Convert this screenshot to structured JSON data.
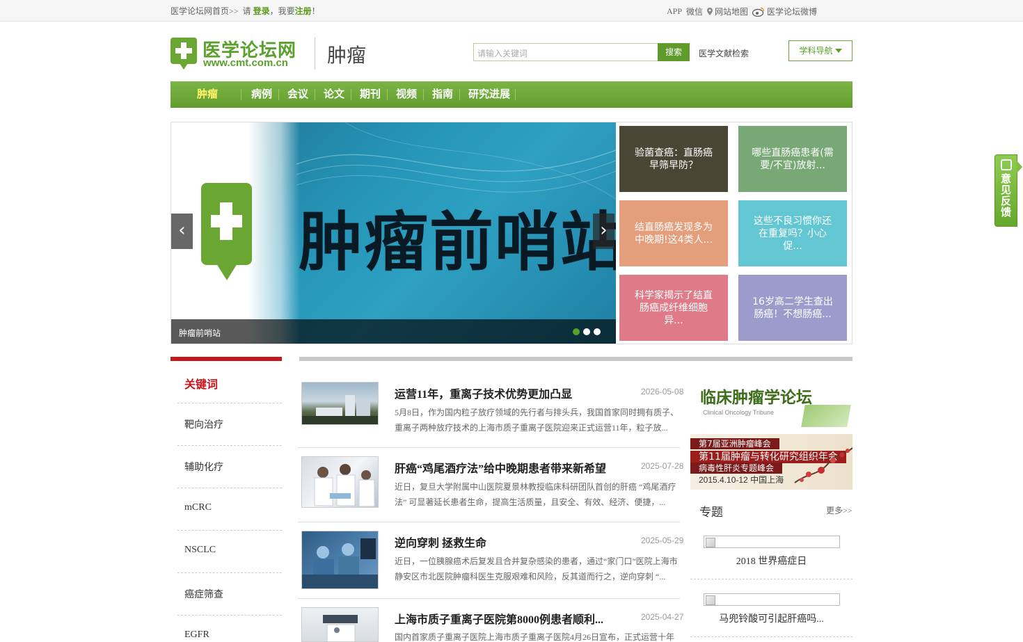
{
  "topbar": {
    "home_link": "医学论坛网首页>>",
    "please": "请",
    "login": "登录",
    "want": "，我要",
    "register": "注册",
    "exclaim": "！",
    "app": "APP",
    "wechat": "微信",
    "sitemap": "网站地图",
    "weibo": "医学论坛微博"
  },
  "header": {
    "logo_cn": "医学论坛网",
    "logo_url": "www.cmt.com.cn",
    "section_title": "肿瘤",
    "search_placeholder": "请输入关键词",
    "search_button": "搜索",
    "lit_search": "医学文献检索",
    "subject_nav": "学科导航"
  },
  "nav": {
    "items": [
      "肿瘤",
      "病例",
      "会议",
      "论文",
      "期刊",
      "视频",
      "指南",
      "研究进展"
    ],
    "active": "肿瘤"
  },
  "slider": {
    "banner_text": "肿瘤前哨站",
    "caption": "肿瘤前哨站",
    "prev": "‹",
    "next": "›",
    "dots_total": 3,
    "dot_active": 1
  },
  "tiles": [
    {
      "text": "验菌查癌：直肠癌早筛早防？",
      "color": "#4a4636"
    },
    {
      "text": "哪些直肠癌患者(需要/不宜)放射...",
      "color": "#77a876"
    },
    {
      "text": "结直肠癌发现多为中晚期!这4类人...",
      "color": "#e59e7b"
    },
    {
      "text": "这些不良习惯你还在重复吗？小心促...",
      "color": "#63c7d3"
    },
    {
      "text": "科学家揭示了结直肠癌成纤维细胞异...",
      "color": "#df7b88"
    },
    {
      "text": "16岁高二学生查出肠癌！不想肠癌...",
      "color": "#9b9ccb"
    }
  ],
  "keywords": {
    "heading": "关键词",
    "items": [
      "靶向治疗",
      "辅助化疗",
      "mCRC",
      "NSCLC",
      "癌症筛查",
      "EGFR"
    ]
  },
  "news": [
    {
      "title": "运营11年，重离子技术优势更加凸显",
      "date": "2026-05-08",
      "summary": "5月8日，作为国内粒子放疗领域的先行者与排头兵，我国首家同时拥有质子、重离子两种放疗技术的上海市质子重离子医院迎来正式运营11年，粒子放..."
    },
    {
      "title": "肝癌“鸡尾酒疗法”给中晚期患者带来新希望",
      "date": "2025-07-28",
      "summary": "近日，复旦大学附属中山医院夏景林教授临床科研团队首创的肝癌 “鸡尾酒疗法” 可显著延长患者生命，提高生活质量，且安全、有效、经济、便捷，..."
    },
    {
      "title": "逆向穿刺 拯救生命",
      "date": "2025-05-29",
      "summary": "近日，一位胰腺癌术后复发且合并复杂感染的患者，通过“家门口”医院上海市静安区市北医院肿瘤科医生克服艰难和风险，反其道而行之，逆向穿刺 “..."
    },
    {
      "title": "上海市质子重离子医院第8000例患者顺利...",
      "date": "2025-04-27",
      "summary": "国内首家质子重离子医院上海市质子重离子医院4月26日宣布，正式运营十年"
    }
  ],
  "right": {
    "banner1_title": "临床肿瘤学论坛",
    "banner1_sub": "Clinical Oncology Tribune",
    "banner2_lines": [
      "第7届亚洲肿瘤峰会",
      "第11届肿瘤与转化研究组织年会",
      "病毒性肝炎专题峰会"
    ],
    "banner2_date": "2015.4.10-12  中国上海",
    "topic_heading": "专题",
    "topic_more": "更多>>",
    "topics": [
      "2018 世界癌症日",
      "马兜铃酸可引起肝癌吗..."
    ]
  },
  "feedback": {
    "label": "意见反馈"
  },
  "colors": {
    "brand_green": "#629e2d",
    "accent_red": "#c8161d"
  }
}
